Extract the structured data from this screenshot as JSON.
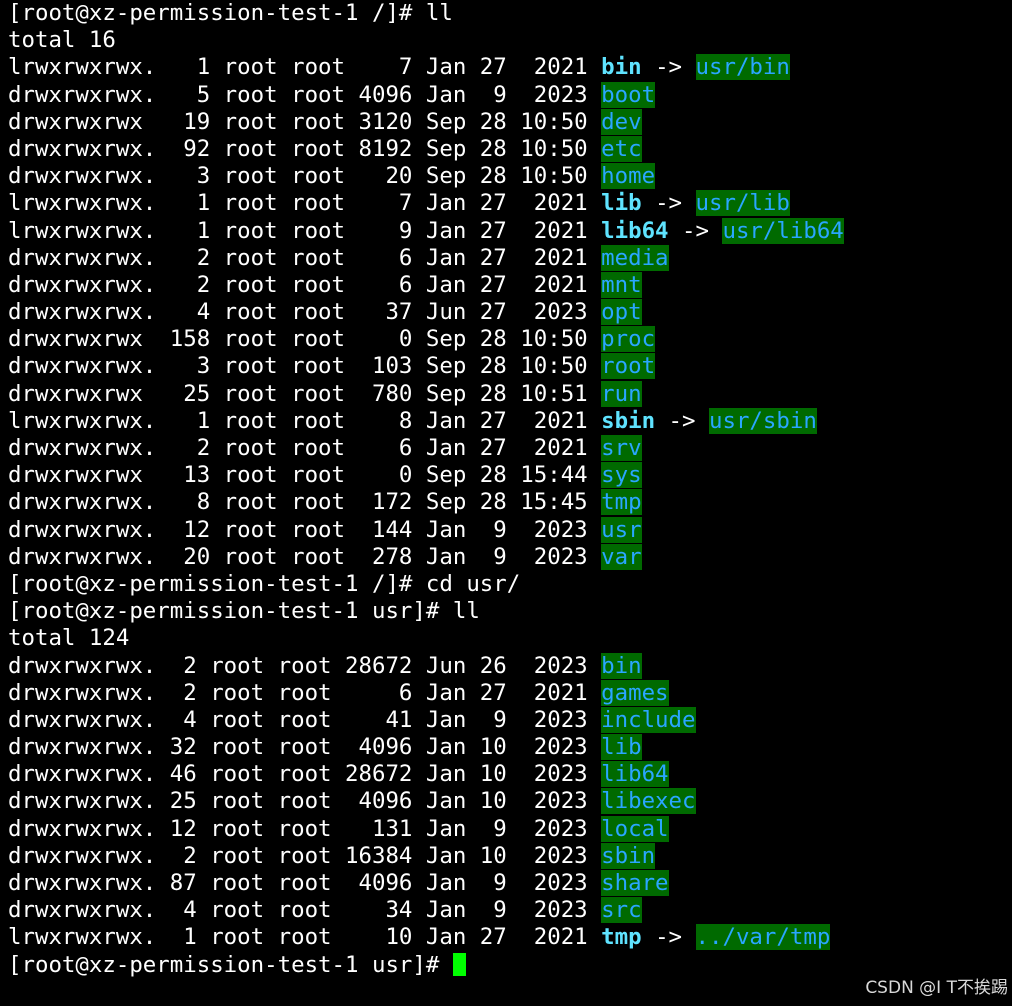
{
  "window": {
    "title": "",
    "colors": {
      "background": "#000000",
      "foreground": "#ffffff",
      "dir_fg": "#2aa6ff",
      "dir_bg": "#006a00",
      "symlink_name": "#5fe3ff",
      "cursor": "#00ff00"
    }
  },
  "watermark": "CSDN @I T不挨踢",
  "session": [
    {
      "type": "prompt",
      "prompt": "[root@xz-permission-test-1 /]# ",
      "command": "ll"
    },
    {
      "type": "text",
      "text": "total 16"
    },
    {
      "type": "entry",
      "prefix": "lrwxrwxrwx.   1 root root    7 Jan 27  2021 ",
      "name": "bin",
      "kind": "link",
      "arrow": " -> ",
      "target": "usr/bin"
    },
    {
      "type": "entry",
      "prefix": "drwxrwxrwx.   5 root root 4096 Jan  9  2023 ",
      "name": "boot",
      "kind": "dir"
    },
    {
      "type": "entry",
      "prefix": "drwxrwxrwx   19 root root 3120 Sep 28 10:50 ",
      "name": "dev",
      "kind": "dir"
    },
    {
      "type": "entry",
      "prefix": "drwxrwxrwx.  92 root root 8192 Sep 28 10:50 ",
      "name": "etc",
      "kind": "dir"
    },
    {
      "type": "entry",
      "prefix": "drwxrwxrwx.   3 root root   20 Sep 28 10:50 ",
      "name": "home",
      "kind": "dir"
    },
    {
      "type": "entry",
      "prefix": "lrwxrwxrwx.   1 root root    7 Jan 27  2021 ",
      "name": "lib",
      "kind": "link",
      "arrow": " -> ",
      "target": "usr/lib"
    },
    {
      "type": "entry",
      "prefix": "lrwxrwxrwx.   1 root root    9 Jan 27  2021 ",
      "name": "lib64",
      "kind": "link",
      "arrow": " -> ",
      "target": "usr/lib64"
    },
    {
      "type": "entry",
      "prefix": "drwxrwxrwx.   2 root root    6 Jan 27  2021 ",
      "name": "media",
      "kind": "dir"
    },
    {
      "type": "entry",
      "prefix": "drwxrwxrwx.   2 root root    6 Jan 27  2021 ",
      "name": "mnt",
      "kind": "dir"
    },
    {
      "type": "entry",
      "prefix": "drwxrwxrwx.   4 root root   37 Jun 27  2023 ",
      "name": "opt",
      "kind": "dir"
    },
    {
      "type": "entry",
      "prefix": "drwxrwxrwx  158 root root    0 Sep 28 10:50 ",
      "name": "proc",
      "kind": "dir"
    },
    {
      "type": "entry",
      "prefix": "drwxrwxrwx.   3 root root  103 Sep 28 10:50 ",
      "name": "root",
      "kind": "dir"
    },
    {
      "type": "entry",
      "prefix": "drwxrwxrwx   25 root root  780 Sep 28 10:51 ",
      "name": "run",
      "kind": "dir"
    },
    {
      "type": "entry",
      "prefix": "lrwxrwxrwx.   1 root root    8 Jan 27  2021 ",
      "name": "sbin",
      "kind": "link",
      "arrow": " -> ",
      "target": "usr/sbin"
    },
    {
      "type": "entry",
      "prefix": "drwxrwxrwx.   2 root root    6 Jan 27  2021 ",
      "name": "srv",
      "kind": "dir"
    },
    {
      "type": "entry",
      "prefix": "drwxrwxrwx   13 root root    0 Sep 28 15:44 ",
      "name": "sys",
      "kind": "dir"
    },
    {
      "type": "entry",
      "prefix": "drwxrwxrwx.   8 root root  172 Sep 28 15:45 ",
      "name": "tmp",
      "kind": "dir"
    },
    {
      "type": "entry",
      "prefix": "drwxrwxrwx.  12 root root  144 Jan  9  2023 ",
      "name": "usr",
      "kind": "dir"
    },
    {
      "type": "entry",
      "prefix": "drwxrwxrwx.  20 root root  278 Jan  9  2023 ",
      "name": "var",
      "kind": "dir"
    },
    {
      "type": "prompt",
      "prompt": "[root@xz-permission-test-1 /]# ",
      "command": "cd usr/"
    },
    {
      "type": "prompt",
      "prompt": "[root@xz-permission-test-1 usr]# ",
      "command": "ll"
    },
    {
      "type": "text",
      "text": "total 124"
    },
    {
      "type": "entry",
      "prefix": "drwxrwxrwx.  2 root root 28672 Jun 26  2023 ",
      "name": "bin",
      "kind": "dir"
    },
    {
      "type": "entry",
      "prefix": "drwxrwxrwx.  2 root root     6 Jan 27  2021 ",
      "name": "games",
      "kind": "dir"
    },
    {
      "type": "entry",
      "prefix": "drwxrwxrwx.  4 root root    41 Jan  9  2023 ",
      "name": "include",
      "kind": "dir"
    },
    {
      "type": "entry",
      "prefix": "drwxrwxrwx. 32 root root  4096 Jan 10  2023 ",
      "name": "lib",
      "kind": "dir"
    },
    {
      "type": "entry",
      "prefix": "drwxrwxrwx. 46 root root 28672 Jan 10  2023 ",
      "name": "lib64",
      "kind": "dir"
    },
    {
      "type": "entry",
      "prefix": "drwxrwxrwx. 25 root root  4096 Jan 10  2023 ",
      "name": "libexec",
      "kind": "dir"
    },
    {
      "type": "entry",
      "prefix": "drwxrwxrwx. 12 root root   131 Jan  9  2023 ",
      "name": "local",
      "kind": "dir"
    },
    {
      "type": "entry",
      "prefix": "drwxrwxrwx.  2 root root 16384 Jan 10  2023 ",
      "name": "sbin",
      "kind": "dir"
    },
    {
      "type": "entry",
      "prefix": "drwxrwxrwx. 87 root root  4096 Jan  9  2023 ",
      "name": "share",
      "kind": "dir"
    },
    {
      "type": "entry",
      "prefix": "drwxrwxrwx.  4 root root    34 Jan  9  2023 ",
      "name": "src",
      "kind": "dir"
    },
    {
      "type": "entry",
      "prefix": "lrwxrwxrwx.  1 root root    10 Jan 27  2021 ",
      "name": "tmp",
      "kind": "link",
      "arrow": " -> ",
      "target": "../var/tmp"
    },
    {
      "type": "prompt",
      "prompt": "[root@xz-permission-test-1 usr]# ",
      "command": "",
      "cursor": true
    }
  ]
}
